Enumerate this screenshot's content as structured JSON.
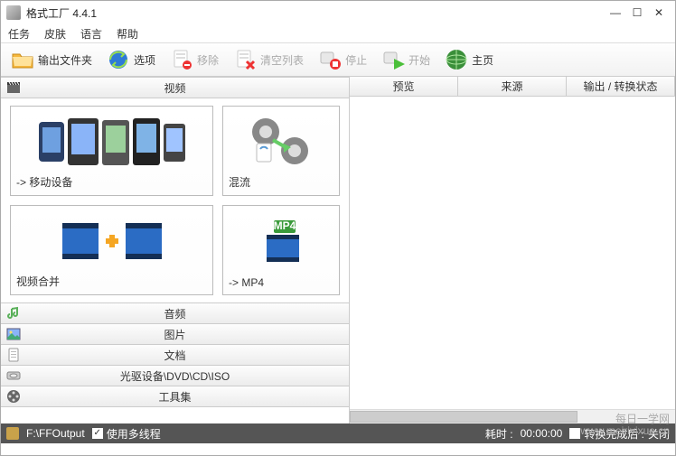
{
  "title": "格式工厂 4.4.1",
  "menu": {
    "task": "任务",
    "skin": "皮肤",
    "lang": "语言",
    "help": "帮助"
  },
  "toolbar": {
    "output": "输出文件夹",
    "options": "选项",
    "remove": "移除",
    "clear": "清空列表",
    "stop": "停止",
    "start": "开始",
    "home": "主页"
  },
  "left": {
    "video": "视频",
    "tiles": {
      "mobile": "-> 移动设备",
      "mux": "混流",
      "join": "视频合并",
      "mp4": "-> MP4"
    },
    "audio": "音频",
    "image": "图片",
    "document": "文档",
    "disc": "光驱设备\\DVD\\CD\\ISO",
    "tools": "工具集"
  },
  "right": {
    "preview": "预览",
    "source": "来源",
    "status": "输出 / 转换状态"
  },
  "status": {
    "path": "F:\\FFOutput",
    "multi": "使用多线程",
    "elapsed_label": "耗时 :",
    "elapsed_value": "00:00:00",
    "after_label": "转换完成后 :",
    "after_value": "关闭"
  },
  "watermark1": "每日一学网",
  "watermark2": "www.meiriyixue.cn"
}
